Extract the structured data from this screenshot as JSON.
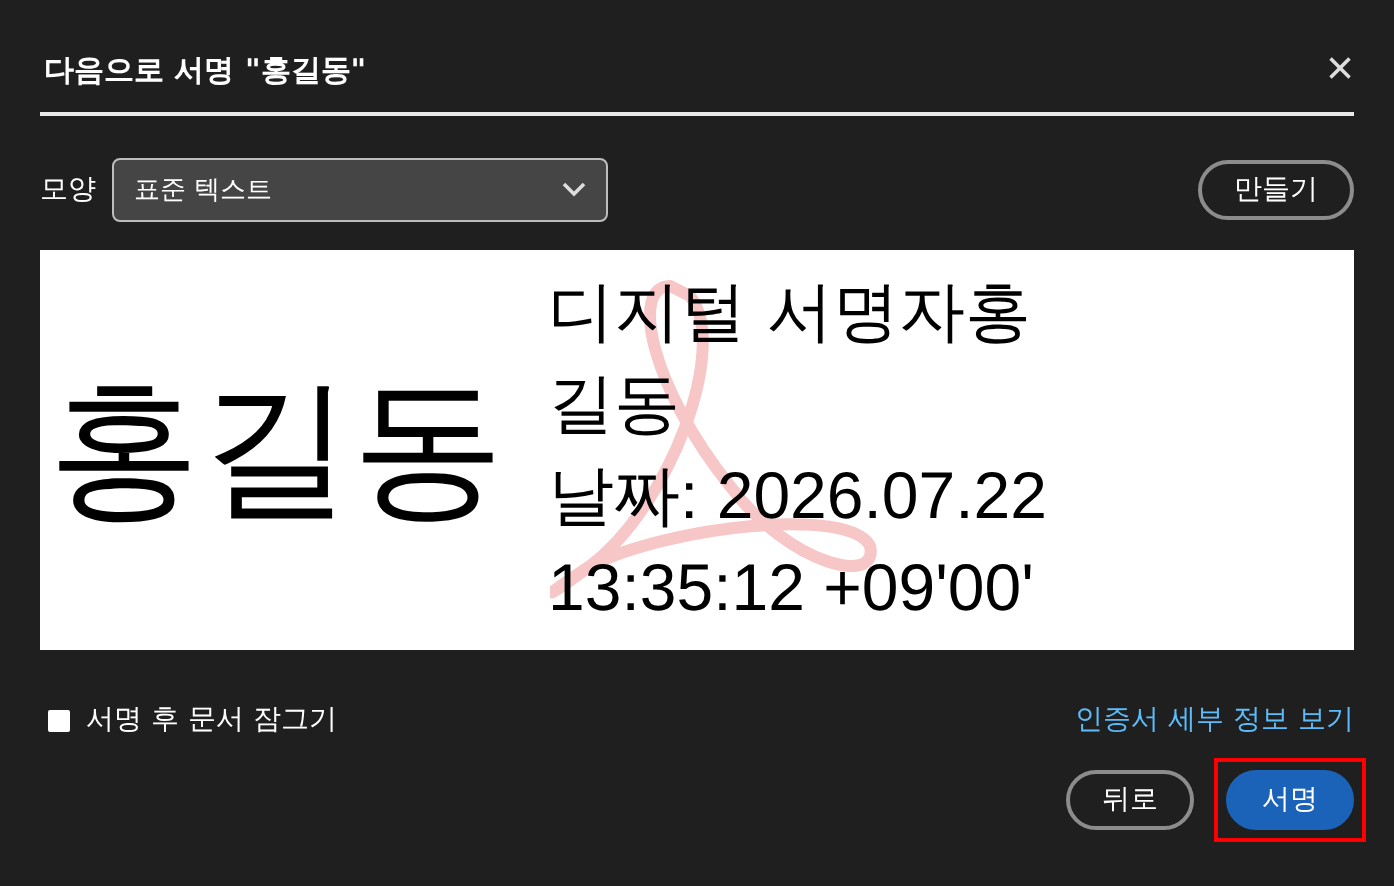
{
  "window": {
    "title": "다음으로 서명 \"홍길동\"",
    "close": "×"
  },
  "appearance": {
    "label": "모양",
    "value": "표준 텍스트",
    "create_button": "만들기"
  },
  "preview": {
    "name": "홍길동",
    "details": [
      "디지털 서명자홍",
      "길동",
      "날짜: 2026.07.22",
      "13:35:12 +09'00'"
    ]
  },
  "lock": {
    "label": "서명 후 문서 잠그기",
    "checked": false
  },
  "certificate_link": "인증서 세부 정보 보기",
  "buttons": [
    {
      "label": "뒤로",
      "kind": "secondary",
      "highlighted": false
    },
    {
      "label": "서명",
      "kind": "primary",
      "highlighted": true
    }
  ]
}
